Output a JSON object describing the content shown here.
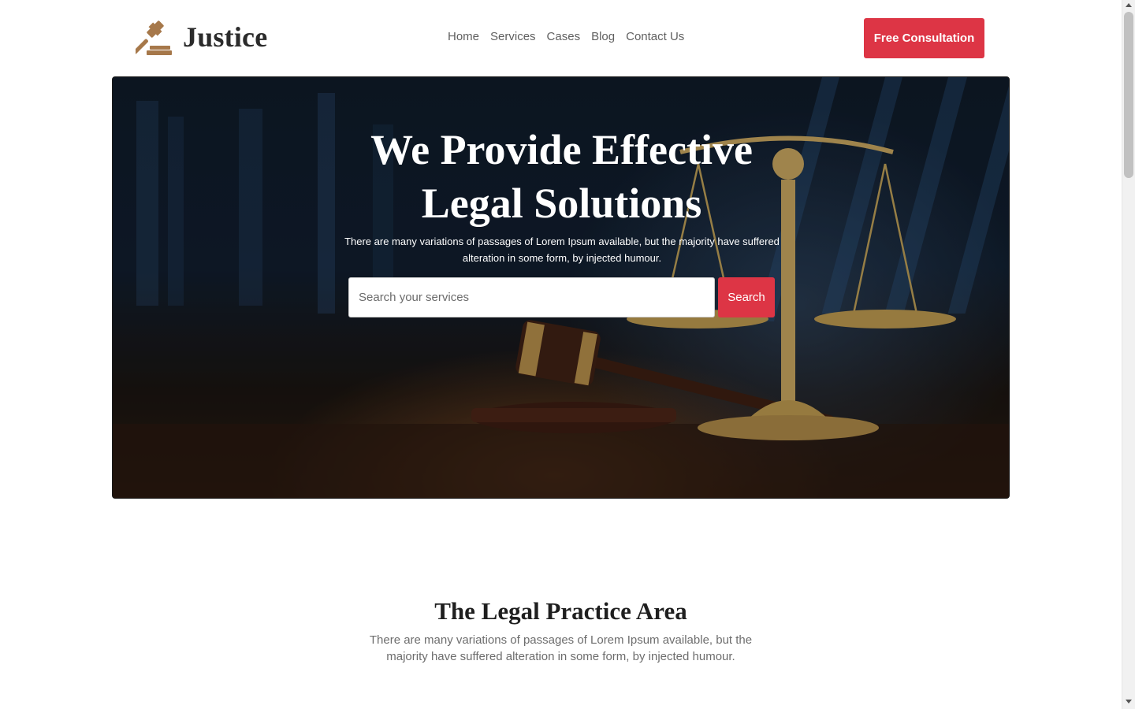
{
  "brand": {
    "name": "Justice",
    "icon": "gavel-icon",
    "icon_color": "#a6784a"
  },
  "nav": {
    "items": [
      "Home",
      "Services",
      "Cases",
      "Blog",
      "Contact Us"
    ]
  },
  "header": {
    "cta_label": "Free Consultation"
  },
  "hero": {
    "title_line1": "We Provide Effective",
    "title_line2": "Legal Solutions",
    "subtitle": "There are many variations of passages of Lorem Ipsum available, but the majority have suffered alteration in some form, by injected humour.",
    "search_placeholder": "Search your services",
    "search_button": "Search"
  },
  "practice": {
    "title": "The Legal Practice Area",
    "subtitle": "There are many variations of passages of Lorem Ipsum available, but the majority have suffered alteration in some form, by injected humour."
  },
  "colors": {
    "accent": "#dd3545",
    "text_dark": "#2b2b2b",
    "text_muted": "#6d6d6d"
  }
}
